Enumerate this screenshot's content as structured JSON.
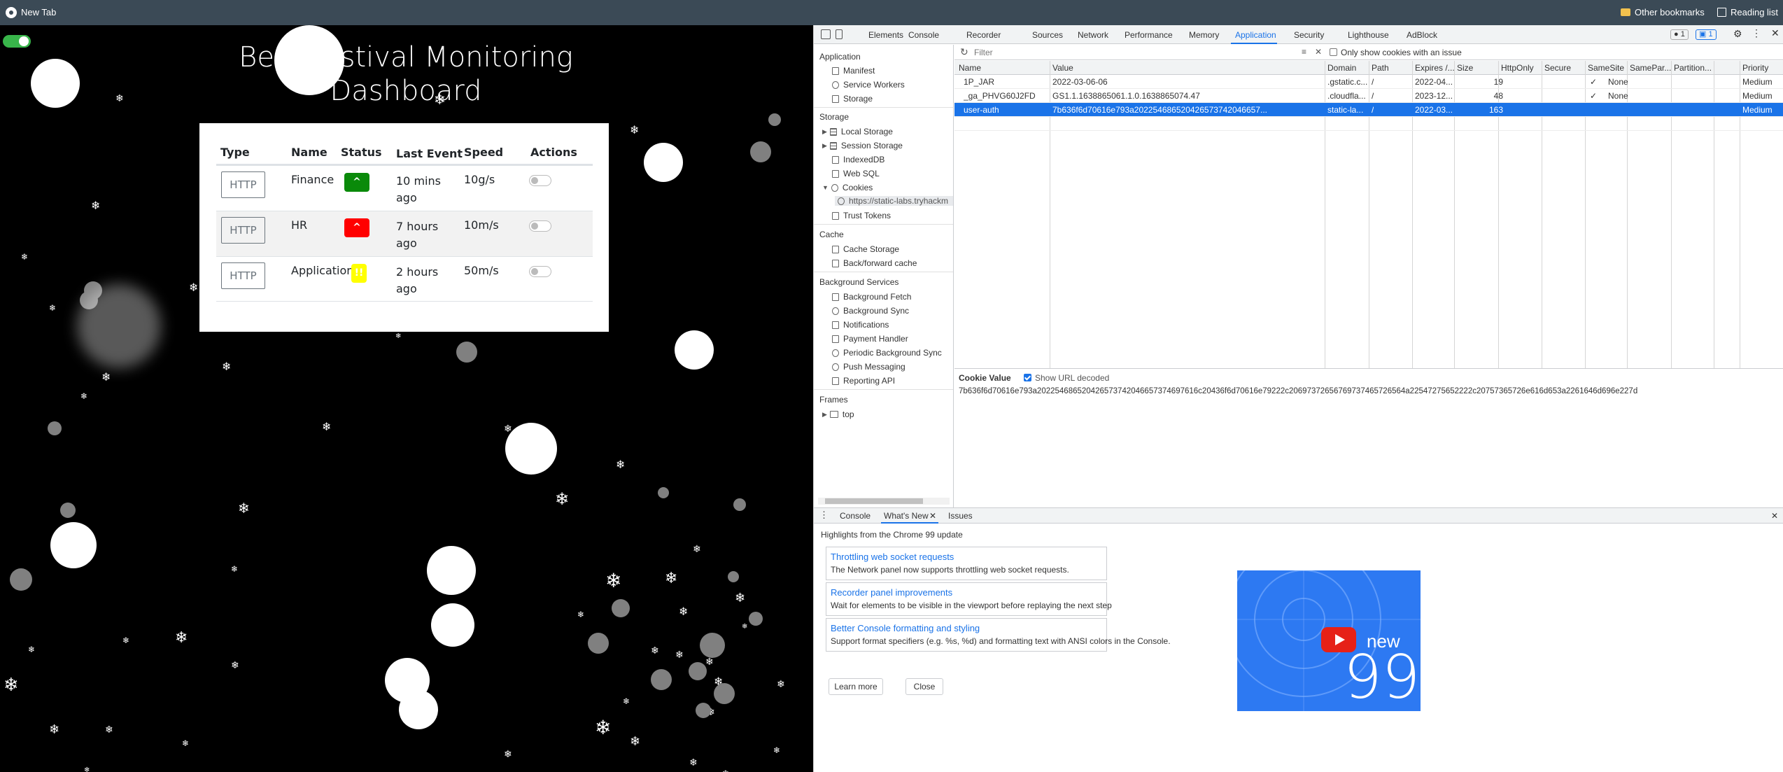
{
  "browser": {
    "tab_title": "New Tab",
    "other_bookmarks": "Other bookmarks",
    "reading_list": "Reading list"
  },
  "page": {
    "title": "Best Festival Monitoring Dashboard",
    "table": {
      "headers": [
        "Type",
        "Name",
        "Status",
        "Last Event",
        "Speed",
        "Actions"
      ],
      "rows": [
        {
          "type": "HTTP",
          "name": "Finance",
          "status_symbol": "^",
          "status_color": "#0a8a0a",
          "last_event": "10 mins ago",
          "speed": "10g/s"
        },
        {
          "type": "HTTP",
          "name": "HR",
          "status_symbol": "^",
          "status_color": "#ff0000",
          "last_event": "7 hours ago",
          "speed": "10m/s"
        },
        {
          "type": "HTTP",
          "name": "Application",
          "status_symbol": "!!",
          "status_color": "#ffff00",
          "last_event": "2 hours ago",
          "speed": "50m/s"
        }
      ]
    }
  },
  "devtools": {
    "tabs": [
      "Elements",
      "Console",
      "Recorder",
      "Sources",
      "Network",
      "Performance",
      "Memory",
      "Application",
      "Security",
      "Lighthouse",
      "AdBlock"
    ],
    "active_tab": "Application",
    "badge_errors": "1",
    "badge_messages": "1",
    "sidebar": {
      "application_label": "Application",
      "application_items": [
        "Manifest",
        "Service Workers",
        "Storage"
      ],
      "storage_label": "Storage",
      "storage_items": [
        "Local Storage",
        "Session Storage",
        "IndexedDB",
        "Web SQL",
        "Cookies"
      ],
      "cookie_origin": "https://static-labs.tryhackm",
      "trust_tokens": "Trust Tokens",
      "cache_label": "Cache",
      "cache_items": [
        "Cache Storage",
        "Back/forward cache"
      ],
      "bg_label": "Background Services",
      "bg_items": [
        "Background Fetch",
        "Background Sync",
        "Notifications",
        "Payment Handler",
        "Periodic Background Sync",
        "Push Messaging",
        "Reporting API"
      ],
      "frames_label": "Frames",
      "frames_items": [
        "top"
      ]
    },
    "filter_placeholder": "Filter",
    "only_issue_label": "Only show cookies with an issue",
    "cookie_columns": [
      "Name",
      "Value",
      "Domain",
      "Path",
      "Expires /...",
      "Size",
      "HttpOnly",
      "Secure",
      "SameSite",
      "SamePar...",
      "Partition...",
      "Priority"
    ],
    "cookies": [
      {
        "name": "1P_JAR",
        "value": "2022-03-06-06",
        "domain": ".gstatic.c...",
        "path": "/",
        "expires": "2022-04...",
        "size": "19",
        "httponly": "",
        "secure": "✓",
        "samesite": "None",
        "samepar": "",
        "partition": "",
        "priority": "Medium"
      },
      {
        "name": "_ga_PHVG60J2FD",
        "value": "GS1.1.1638865061.1.0.1638865074.47",
        "domain": ".cloudfla...",
        "path": "/",
        "expires": "2023-12...",
        "size": "48",
        "httponly": "",
        "secure": "✓",
        "samesite": "None",
        "samepar": "",
        "partition": "",
        "priority": "Medium"
      },
      {
        "name": "user-auth",
        "value": "7b636f6d70616e793a202254686520426573742046657...",
        "domain": "static-la...",
        "path": "/",
        "expires": "2022-03...",
        "size": "163",
        "httponly": "",
        "secure": "",
        "samesite": "",
        "samepar": "",
        "partition": "",
        "priority": "Medium"
      }
    ],
    "cookie_value_label": "Cookie Value",
    "show_url_decoded": "Show URL decoded",
    "cookie_value": "7b636f6d70616e793a202254686520426573742046657374697616c20436f6d70616e79222c20697372656769737465726564a22547275652222c20757365726e616d653a2261646d696e227d",
    "drawer": {
      "tabs": [
        "Console",
        "What's New",
        "Issues"
      ],
      "headline": "Highlights from the Chrome 99 update",
      "items": [
        {
          "title": "Throttling web socket requests",
          "desc": "The Network panel now supports throttling web socket requests."
        },
        {
          "title": "Recorder panel improvements",
          "desc": "Wait for elements to be visible in the viewport before replaying the next step"
        },
        {
          "title": "Better Console formatting and styling",
          "desc": "Support format specifiers (e.g. %s, %d) and formatting text with ANSI colors in the Console."
        }
      ],
      "learn_more": "Learn more",
      "close": "Close",
      "promo_new": "new",
      "promo_version": "99"
    }
  }
}
